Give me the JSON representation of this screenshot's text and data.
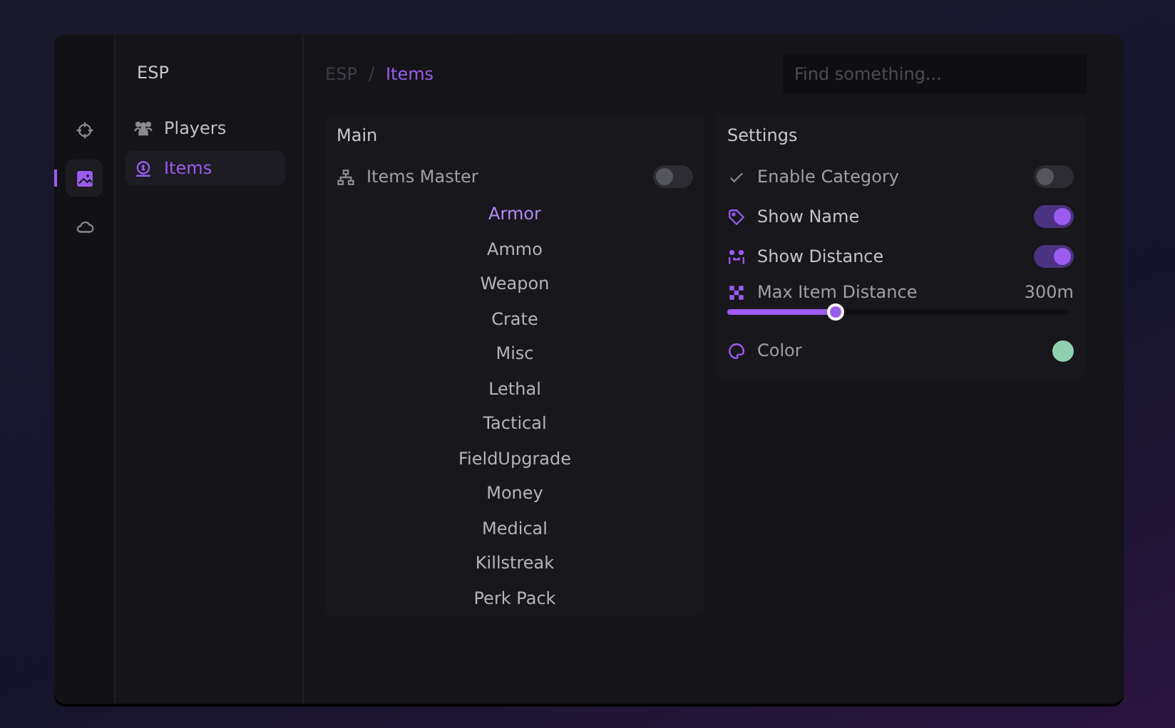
{
  "rail": [
    {
      "kind": "crosshair",
      "selected": false
    },
    {
      "kind": "image",
      "selected": true
    },
    {
      "kind": "cloud",
      "selected": false
    }
  ],
  "nav": {
    "title": "ESP",
    "items": [
      {
        "label": "Players",
        "kind": "people",
        "selected": false
      },
      {
        "label": "Items",
        "kind": "coin",
        "selected": true
      }
    ]
  },
  "breadcrumb": {
    "parent": "ESP",
    "separator": "/",
    "current": "Items"
  },
  "search": {
    "placeholder": "Find something..."
  },
  "main": {
    "title": "Main",
    "master": {
      "label": "Items Master",
      "on": false
    },
    "items": [
      {
        "label": "Armor",
        "selected": true
      },
      {
        "label": "Ammo",
        "selected": false
      },
      {
        "label": "Weapon",
        "selected": false
      },
      {
        "label": "Crate",
        "selected": false
      },
      {
        "label": "Misc",
        "selected": false
      },
      {
        "label": "Lethal",
        "selected": false
      },
      {
        "label": "Tactical",
        "selected": false
      },
      {
        "label": "FieldUpgrade",
        "selected": false
      },
      {
        "label": "Money",
        "selected": false
      },
      {
        "label": "Medical",
        "selected": false
      },
      {
        "label": "Killstreak",
        "selected": false
      },
      {
        "label": "Perk Pack",
        "selected": false
      }
    ]
  },
  "settings": {
    "title": "Settings",
    "rows": [
      {
        "kind": "toggle",
        "label": "Enable Category",
        "on": false
      },
      {
        "kind": "toggle",
        "label": "Show Name",
        "on": true
      },
      {
        "kind": "toggle",
        "label": "Show Distance",
        "on": true
      },
      {
        "kind": "slider",
        "label": "Max Item Distance",
        "reading": "300m",
        "level": 0.32
      },
      {
        "kind": "color",
        "label": "Color",
        "color": "#8fd1ae"
      }
    ]
  }
}
